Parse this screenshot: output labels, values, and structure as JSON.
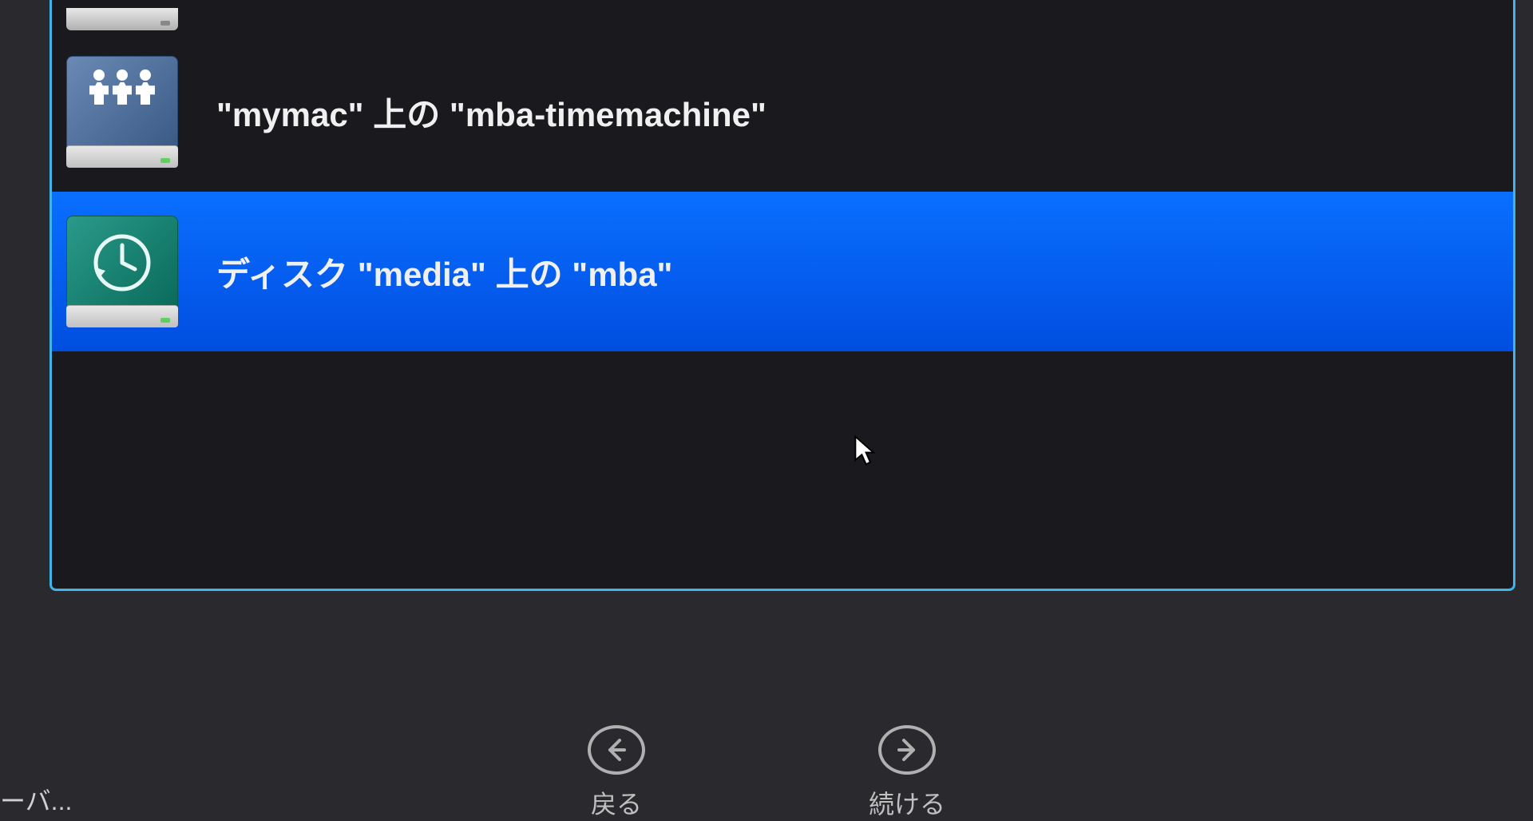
{
  "list": {
    "items": [
      {
        "label": "\"mymac\" 上の \"mba-timemachine\"",
        "icon": "network-drive-icon",
        "selected": false
      },
      {
        "label": "ディスク \"media\" 上の \"mba\"",
        "icon": "timemachine-drive-icon",
        "selected": true
      }
    ]
  },
  "controls": {
    "back_label": "戻る",
    "continue_label": "続ける"
  },
  "bottom_left": "ーバ...",
  "colors": {
    "selection": "#0a6fff",
    "panel_border": "#3fb5ea"
  }
}
